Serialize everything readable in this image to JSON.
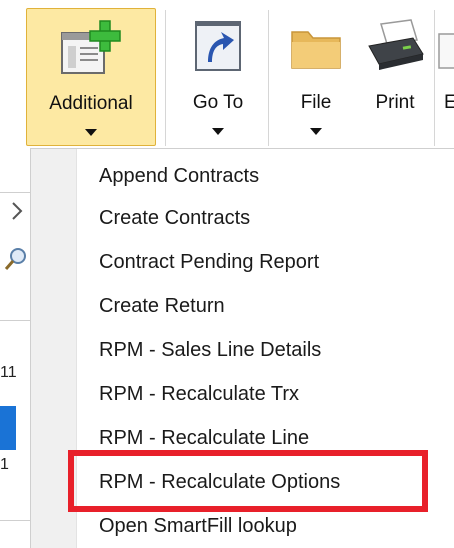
{
  "ribbon": {
    "buttons": [
      {
        "label": "Additional",
        "icon": "add-window-icon",
        "active": true
      },
      {
        "label": "Go To",
        "icon": "goto-arrow-icon",
        "active": false
      },
      {
        "label": "File",
        "icon": "folder-icon",
        "active": false
      },
      {
        "label": "Print",
        "icon": "printer-icon",
        "active": false
      },
      {
        "label": "E",
        "icon": "",
        "active": false
      }
    ]
  },
  "left_strip": {
    "fragments": [
      "11",
      "1"
    ]
  },
  "menu": {
    "items": [
      {
        "label": "Append Contracts"
      },
      {
        "label": "Create Contracts"
      },
      {
        "label": "Contract Pending Report"
      },
      {
        "label": "Create Return"
      },
      {
        "label": "RPM - Sales Line Details"
      },
      {
        "label": "RPM - Recalculate Trx"
      },
      {
        "label": "RPM - Recalculate Line"
      },
      {
        "label": "RPM - Recalculate Options"
      },
      {
        "label": "Open SmartFill lookup"
      }
    ],
    "highlighted_item": "RPM - Recalculate Options"
  },
  "colors": {
    "active_button_bg": "#fde9a3",
    "active_button_border": "#e0b23a",
    "highlight_box": "#e8202a",
    "selection_blue": "#1a73d6"
  }
}
